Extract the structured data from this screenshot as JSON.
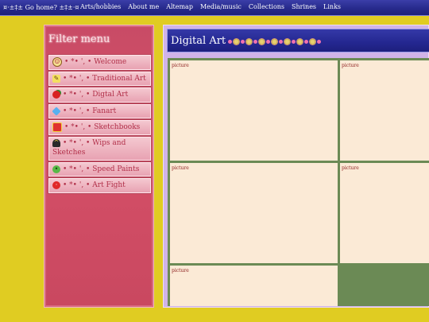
{
  "topnav": {
    "home_label": "¤·±‡± Go home? ±‡±·¤",
    "links": [
      "Arts/hobbies",
      "About me",
      "Altemap",
      "Media/music",
      "Collections",
      "Shrines",
      "Links"
    ]
  },
  "sidebar": {
    "heading": "Filter menu",
    "items": [
      {
        "label": "• *• ', • Welcome",
        "icon": "smiley-icon"
      },
      {
        "label": "• *• ', • Traditional Art",
        "icon": "pencil-icon"
      },
      {
        "label": "• *• ', • Digtal Art",
        "icon": "apple-icon"
      },
      {
        "label": "• *• ', • Fanart",
        "icon": "diamond-icon"
      },
      {
        "label": "• *• ', • Sketchbooks",
        "icon": "sketchbook-icon"
      },
      {
        "label": "• *• ', • Wips and Sketches",
        "icon": "bat-icon"
      },
      {
        "label": "• *• ', • Speed Paints",
        "icon": "green-face-icon"
      },
      {
        "label": "• *• ', • Art Fight",
        "icon": "ladybug-icon"
      }
    ]
  },
  "main": {
    "title": "Digital Art",
    "pictures": [
      "picture",
      "picture",
      "picture",
      "picture",
      "picture"
    ]
  },
  "colors": {
    "background": "#e0cc22",
    "nav": "#272a8c",
    "sidebar": "#c84b66",
    "main_panel": "#d0b3e8",
    "tile": "#fbead6",
    "grid_gap": "#6b8a55"
  }
}
